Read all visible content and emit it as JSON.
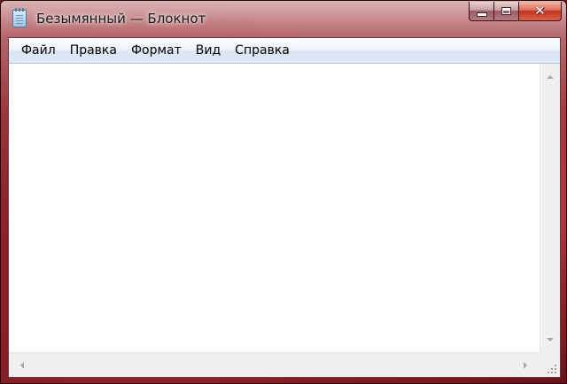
{
  "window": {
    "title": "Безымянный — Блокнот",
    "close_glyph": "✕"
  },
  "menu": {
    "items": [
      {
        "label": "Файл"
      },
      {
        "label": "Правка"
      },
      {
        "label": "Формат"
      },
      {
        "label": "Вид"
      },
      {
        "label": "Справка"
      }
    ]
  },
  "editor": {
    "content": ""
  },
  "icons": {
    "app": "notepad-icon",
    "minimize": "minimize-icon",
    "maximize": "maximize-icon",
    "close": "close-icon",
    "scroll_up": "arrow-up-icon",
    "scroll_down": "arrow-down-icon",
    "scroll_left": "arrow-left-icon",
    "scroll_right": "arrow-right-icon",
    "grip": "size-grip-icon"
  },
  "colors": {
    "frame_accent": "#8a2a32",
    "close_button": "#c2321c",
    "menu_bar": "#dfe9f5"
  }
}
